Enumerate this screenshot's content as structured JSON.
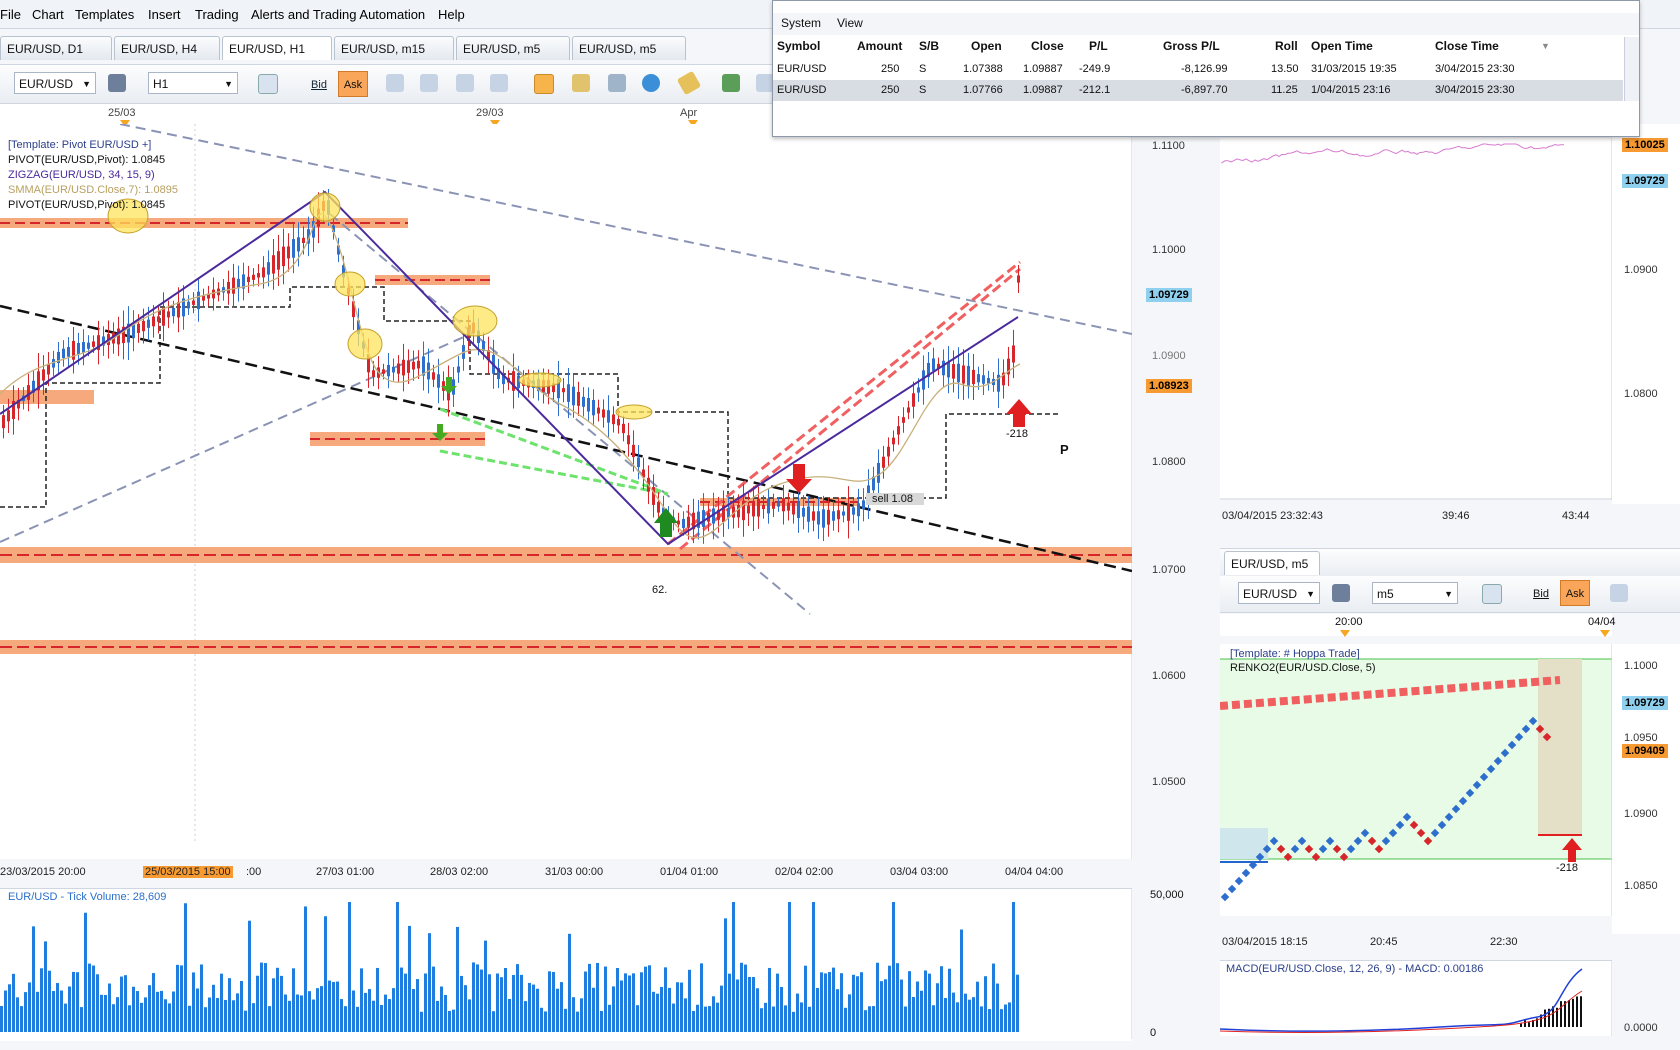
{
  "menu": [
    "File",
    "Chart",
    "Templates",
    "Insert",
    "Trading",
    "Alerts and Trading Automation",
    "Help"
  ],
  "tabs": [
    "EUR/USD, D1",
    "EUR/USD, H4",
    "EUR/USD, H1",
    "EUR/USD, m15",
    "EUR/USD, m5",
    "EUR/USD, m5"
  ],
  "toolbar": {
    "symbol": "EUR/USD",
    "timeframe": "H1",
    "bid": "Bid",
    "ask": "Ask"
  },
  "datebar": {
    "d1": "25/03",
    "d2": "29/03",
    "d3": "Apr"
  },
  "legend": {
    "l1": "[Template: Pivot EUR/USD +]",
    "l2": "PIVOT(EUR/USD,Pivot): 1.0845",
    "l3": "ZIGZAG(EUR/USD, 34, 15, 9)",
    "l4": "SMMA(EUR/USD.Close,7): 1.0895",
    "l5": "PIVOT(EUR/USD,Pivot): 1.0845"
  },
  "main_yaxis": [
    "1.1100",
    "1.1000",
    "1.0900",
    "1.0800",
    "1.0700",
    "1.0600",
    "1.0500"
  ],
  "main_prices": {
    "current": "1.09729",
    "box2": "1.08923"
  },
  "annotations": {
    "fib": "62.",
    "sell": "sell 1.08",
    "pl": "-218",
    "pivot": "P"
  },
  "main_xaxis": [
    "23/03/2015 20:00",
    "25/03/2015 15:00",
    ":00",
    "27/03 01:00",
    "28/03 02:00",
    "31/03 00:00",
    "01/04 01:00",
    "02/04 02:00",
    "03/04 03:00",
    "04/04 04:00"
  ],
  "volume": {
    "header": "EUR/USD - Tick Volume: 28,609",
    "ymax": "50,000",
    "ymin": "0"
  },
  "orders": {
    "menu": [
      "System",
      "View"
    ],
    "headers": [
      "Symbol",
      "Amount",
      "S/B",
      "Open",
      "Close",
      "P/L",
      "Gross P/L",
      "Roll",
      "Open Time",
      "Close Time"
    ],
    "rows": [
      [
        "EUR/USD",
        "250",
        "S",
        "1.07388",
        "1.09887",
        "-249.9",
        "-8,126.99",
        "13.50",
        "31/03/2015 19:35",
        "3/04/2015 23:30"
      ],
      [
        "EUR/USD",
        "250",
        "S",
        "1.07766",
        "1.09887",
        "-212.1",
        "-6,897.70",
        "11.25",
        "1/04/2015 23:16",
        "3/04/2015 23:30"
      ]
    ]
  },
  "top_right": {
    "yaxis": [
      "1.0900",
      "1.0800"
    ],
    "price_top": "1.10025",
    "price_cur": "1.09729",
    "xaxis": [
      "03/04/2015 23:32:43",
      "39:46",
      "43:44"
    ]
  },
  "m5panel": {
    "tab": "EUR/USD, m5",
    "symbol": "EUR/USD",
    "timeframe": "m5",
    "bid": "Bid",
    "ask": "Ask",
    "date_top": [
      "20:00",
      "04/04"
    ],
    "template": "[Template: # Hoppa Trade]",
    "renko": "RENKO2(EUR/USD.Close, 5)",
    "yaxis": [
      "1.1000",
      "1.0950",
      "1.0900",
      "1.0850"
    ],
    "price_cur": "1.09729",
    "price_box": "1.09409",
    "pl": "-218",
    "xaxis": [
      "03/04/2015 18:15",
      "20:45",
      "22:30"
    ],
    "macd": "MACD(EUR/USD.Close, 12, 26, 9) -  MACD: 0.00186",
    "macd_y": "0.0000"
  },
  "colors": {
    "pivot_zone": "#f7a97e",
    "bull": "#2e6fce",
    "bear": "#d6262b"
  }
}
